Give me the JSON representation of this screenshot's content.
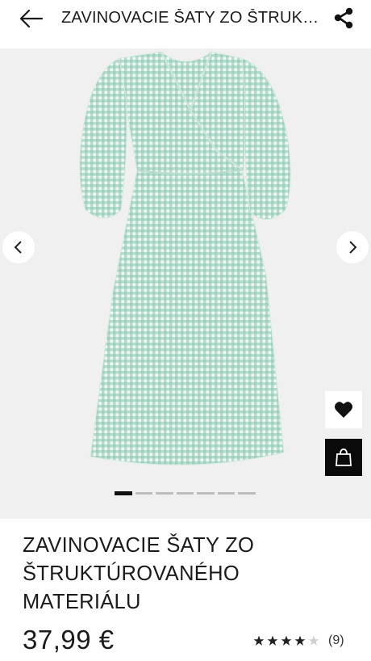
{
  "header": {
    "title": "ZAVINOVACIE ŠATY ZO ŠTRUKT...",
    "back_icon": "arrow-left-icon",
    "share_icon": "share-icon"
  },
  "gallery": {
    "image_count": 7,
    "active_index": 1,
    "background": "#f0f0f0",
    "dress_color": "#8fc9b3",
    "prev_icon": "chevron-left-icon",
    "next_icon": "chevron-right-icon",
    "favorite_icon": "heart-icon",
    "bag_icon": "shopping-bag-icon"
  },
  "product": {
    "name_lines": [
      "ZAVINOVACIE ŠATY ZO",
      "ŠTRUKTÚROVANÉHO",
      "MATERIÁLU"
    ],
    "price": "37,99 €",
    "rating": {
      "filled_stars": 4,
      "max_stars": 5,
      "count_label": "(9)"
    }
  }
}
